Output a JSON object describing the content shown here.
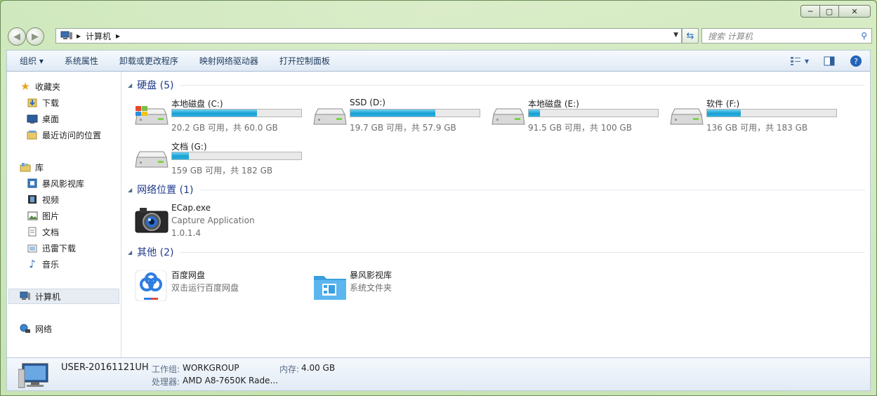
{
  "window": {
    "minimize": "─",
    "maximize": "▢",
    "close": "✕"
  },
  "nav": {
    "back_glyph": "◀",
    "forward_glyph": "▶",
    "address": {
      "separator": "▸",
      "crumb": "计算机",
      "trail": "▸"
    },
    "search_placeholder": "搜索 计算机"
  },
  "toolbar": {
    "organize": "组织 ▾",
    "system_properties": "系统属性",
    "uninstall": "卸载或更改程序",
    "map_drive": "映射网络驱动器",
    "control_panel": "打开控制面板",
    "view_icon": "view-options-icon",
    "preview_icon": "preview-pane-icon",
    "help_icon": "help-icon"
  },
  "sidebar": {
    "favorites": "收藏夹",
    "downloads": "下载",
    "desktop": "桌面",
    "recent": "最近访问的位置",
    "libraries": "库",
    "baofeng": "暴风影视库",
    "videos": "视频",
    "pictures": "图片",
    "documents": "文档",
    "xunlei": "迅雷下载",
    "music": "音乐",
    "computer": "计算机",
    "network": "网络"
  },
  "groups": {
    "hard_disks": "硬盘 (5)",
    "network_locations": "网络位置 (1)",
    "other": "其他 (2)"
  },
  "drives": [
    {
      "name": "本地磁盘 (C:)",
      "detail": "20.2 GB 可用，共 60.0 GB",
      "used_fraction": 0.66,
      "system": true
    },
    {
      "name": "SSD (D:)",
      "detail": "19.7 GB 可用，共 57.9 GB",
      "used_fraction": 0.66,
      "system": false
    },
    {
      "name": "本地磁盘 (E:)",
      "detail": "91.5 GB 可用，共 100 GB",
      "used_fraction": 0.085,
      "system": false
    },
    {
      "name": "软件 (F:)",
      "detail": "136 GB 可用，共 183 GB",
      "used_fraction": 0.26,
      "system": false
    },
    {
      "name": "文档 (G:)",
      "detail": "159 GB 可用，共 182 GB",
      "used_fraction": 0.13,
      "system": false
    }
  ],
  "network_item": {
    "name": "ECap.exe",
    "desc": "Capture Application",
    "version": "1.0.1.4"
  },
  "other_items": [
    {
      "name": "百度网盘",
      "desc": "双击运行百度网盘"
    },
    {
      "name": "暴风影视库",
      "desc": "系统文件夹"
    }
  ],
  "details": {
    "computer_name": "USER-20161121UH",
    "workgroup_label": "工作组:",
    "workgroup": "WORKGROUP",
    "memory_label": "内存:",
    "memory": "4.00 GB",
    "cpu_label": "处理器:",
    "cpu": "AMD A8-7650K Rade..."
  },
  "colors": {
    "drive_fill": "#1a9fd1",
    "group_header": "#1e3a8a",
    "toolbar_text": "#1e3a5c"
  }
}
